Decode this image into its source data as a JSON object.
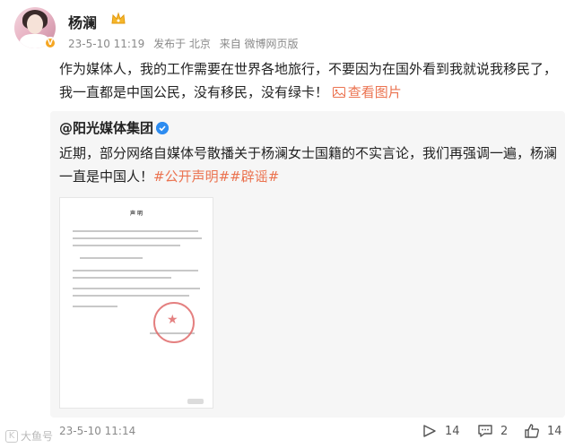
{
  "post": {
    "author": "杨澜",
    "meta": {
      "datetime": "23-5-10 11:19",
      "posted_from": "发布于 北京",
      "source": "来自 微博网页版"
    },
    "text": "作为媒体人，我的工作需要在世界各地旅行，不要因为在国外看到我就说我移民了，我一直都是中国公民，没有移民，没有绿卡！",
    "see_pic_label": "查看图片"
  },
  "repost": {
    "author": "@阳光媒体集团",
    "text": "近期，部分网络自媒体号散播关于杨澜女士国籍的不实言论，我们再强调一遍，杨澜一直是中国人！",
    "tags": "#公开声明##辟谣#",
    "doc_title": "声 明"
  },
  "footer": {
    "time": "23-5-10 11:14",
    "repost_count": "14",
    "comment_count": "2",
    "like_count": "14"
  },
  "brand": {
    "label": "大鱼号"
  },
  "colors": {
    "link": "#eb7350",
    "repost_bg": "#f6f6f6",
    "meta_text": "#8a8a8a"
  }
}
